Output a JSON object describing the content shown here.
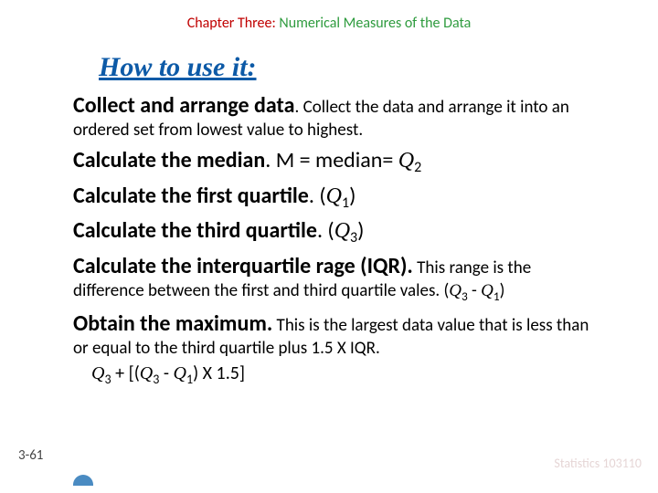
{
  "header": {
    "chapter_label": "Chapter Three: ",
    "chapter_title": "Numerical Measures of the Data"
  },
  "heading": "How to use it:",
  "steps": {
    "s1_lead": "Collect and arrange data",
    "s1_rest": ". Collect the data and arrange it into an ordered set from lowest value to highest.",
    "s2_lead": "Calculate the median",
    "s2_rest_a": ". M = median= ",
    "s2_q": "Q",
    "s2_sub": "2",
    "s3_lead": "Calculate the first quartile",
    "s3_rest_a": ". (",
    "s3_q": "Q",
    "s3_sub": "1",
    "s3_close": ")",
    "s4_lead": "Calculate the third quartile",
    "s4_rest_a": ". (",
    "s4_q": "Q",
    "s4_sub": "3",
    "s4_close": ")",
    "s5_lead": "Calculate the interquartile rage (IQR).",
    "s5_rest_a": " This range is the difference between the first and third quartile vales. (",
    "s5_q1": "Q",
    "s5_sub1": "3",
    "s5_mid": " - ",
    "s5_q2": "Q",
    "s5_sub2": "1",
    "s5_close": ")",
    "s6_lead": "Obtain the maximum.",
    "s6_rest": " This is the largest data value that is less than or equal to the third quartile plus 1.5 X IQR.",
    "s6_line2_a": "Q",
    "s6_line2_sub1": "3",
    "s6_line2_b": " + [(",
    "s6_line2_c": "Q",
    "s6_line2_sub2": "3",
    "s6_line2_d": " - ",
    "s6_line2_e": "Q",
    "s6_line2_sub3": "1",
    "s6_line2_f": ") X 1.5]"
  },
  "page_number": "3-61",
  "footer_right": "Statistics 103110"
}
